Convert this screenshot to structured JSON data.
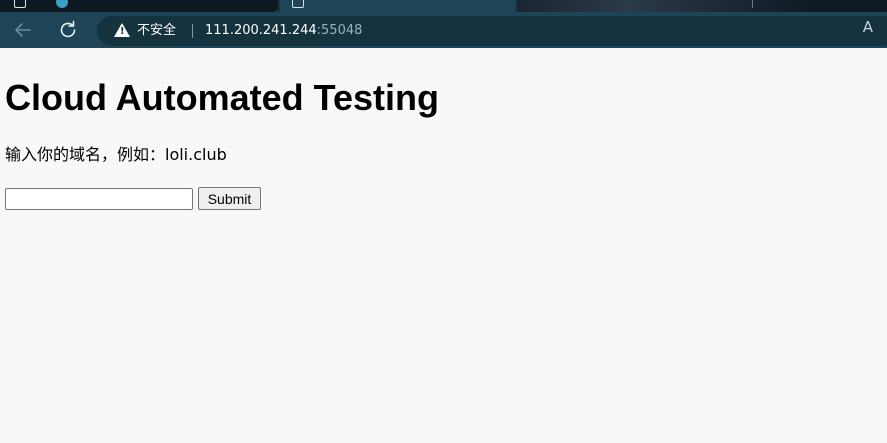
{
  "browser": {
    "security_label": "不安全",
    "url_host": "111.200.241.244",
    "url_port": ":55048",
    "reader_icon": "A",
    "icons": {
      "back": "arrow-left-icon",
      "reload": "reload-icon",
      "security": "warning-triangle-icon",
      "reader": "read-aloud-icon"
    }
  },
  "page": {
    "title": "Cloud Automated Testing",
    "prompt": "输入你的域名，例如：loli.club",
    "domain_input_value": "",
    "submit_label": "Submit"
  },
  "colors": {
    "chrome": "#1e4458",
    "omnibox": "#15323f",
    "page_background": "#f8f8f8"
  }
}
